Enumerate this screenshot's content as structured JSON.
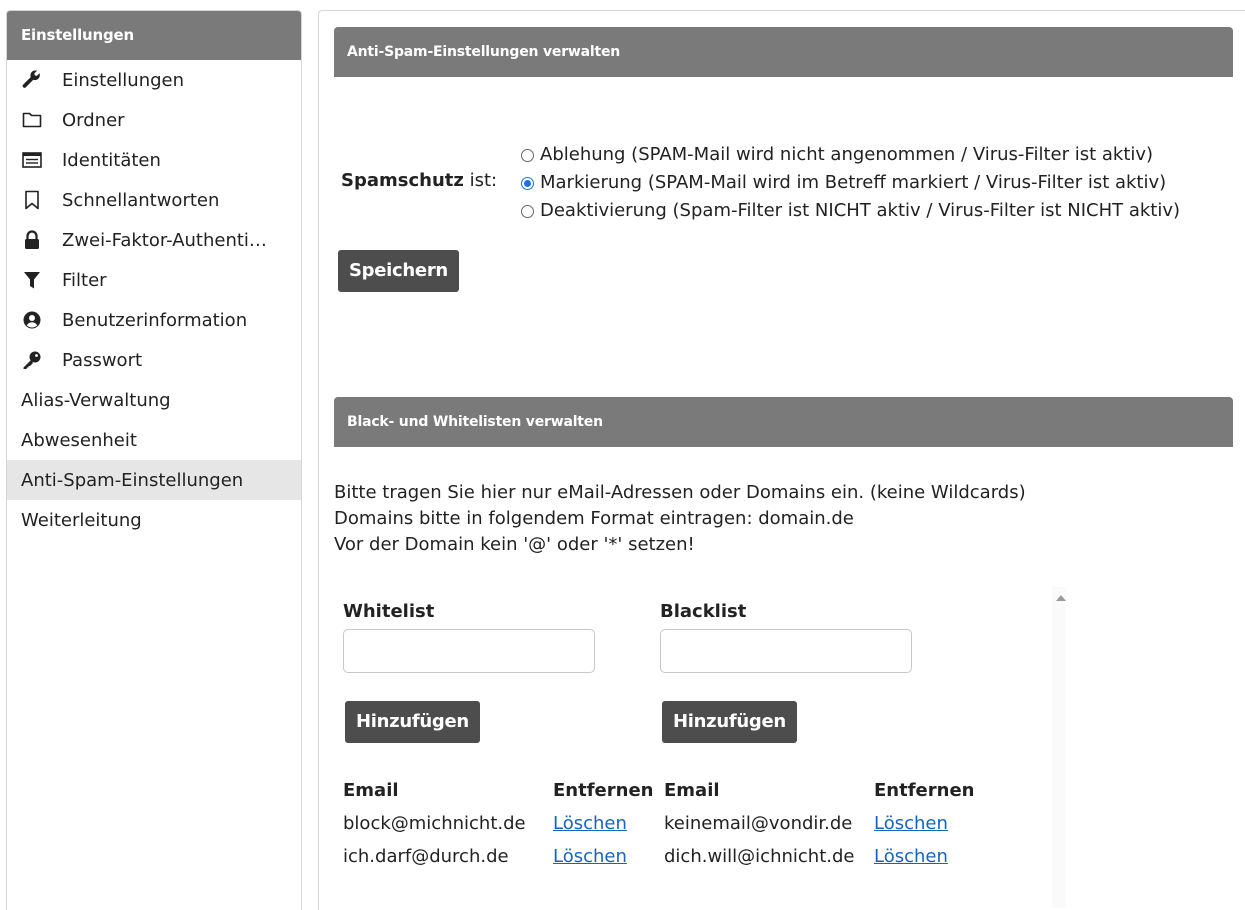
{
  "sidebar": {
    "header": "Einstellungen",
    "items": [
      {
        "label": "Einstellungen",
        "icon": "wrench-icon",
        "active": false
      },
      {
        "label": "Ordner",
        "icon": "folder-icon",
        "active": false
      },
      {
        "label": "Identitäten",
        "icon": "id-card-icon",
        "active": false
      },
      {
        "label": "Schnellantworten",
        "icon": "bookmark-icon",
        "active": false
      },
      {
        "label": "Zwei-Faktor-Authenti…",
        "icon": "lock-icon",
        "active": false
      },
      {
        "label": "Filter",
        "icon": "filter-icon",
        "active": false
      },
      {
        "label": "Benutzerinformation",
        "icon": "user-circle-icon",
        "active": false
      },
      {
        "label": "Passwort",
        "icon": "key-icon",
        "active": false
      },
      {
        "label": "Alias-Verwaltung",
        "icon": "",
        "active": false
      },
      {
        "label": "Abwesenheit",
        "icon": "",
        "active": false
      },
      {
        "label": "Anti-Spam-Einstellungen",
        "icon": "",
        "active": true
      },
      {
        "label": "Weiterleitung",
        "icon": "",
        "active": false
      }
    ]
  },
  "antispam": {
    "header": "Anti-Spam-Einstellungen verwalten",
    "label_bold": "Spamschutz",
    "label_rest": " ist:",
    "options": [
      {
        "label": "Ablehung (SPAM-Mail wird nicht angenommen / Virus-Filter ist aktiv)",
        "checked": false
      },
      {
        "label": "Markierung (SPAM-Mail wird im Betreff markiert / Virus-Filter ist aktiv)",
        "checked": true
      },
      {
        "label": "Deaktivierung (Spam-Filter ist NICHT aktiv / Virus-Filter ist NICHT aktiv)",
        "checked": false
      }
    ],
    "save_label": "Speichern"
  },
  "lists": {
    "header": "Black- und Whitelisten verwalten",
    "info": [
      "Bitte tragen Sie hier nur eMail-Adressen oder Domains ein. (keine Wildcards)",
      "Domains bitte in folgendem Format eintragen: domain.de",
      "Vor der Domain kein '@' oder '*' setzen!"
    ],
    "whitelist": {
      "title": "Whitelist",
      "input_value": "",
      "add_label": "Hinzufügen",
      "col_email": "Email",
      "col_remove": "Entfernen",
      "rows": [
        {
          "email": "block@michnicht.de",
          "action": "Löschen"
        },
        {
          "email": "ich.darf@durch.de",
          "action": "Löschen"
        }
      ]
    },
    "blacklist": {
      "title": "Blacklist",
      "input_value": "",
      "add_label": "Hinzufügen",
      "col_email": "Email",
      "col_remove": "Entfernen",
      "rows": [
        {
          "email": "keinemail@vondir.de",
          "action": "Löschen"
        },
        {
          "email": "dich.will@ichnicht.de",
          "action": "Löschen"
        }
      ]
    }
  }
}
